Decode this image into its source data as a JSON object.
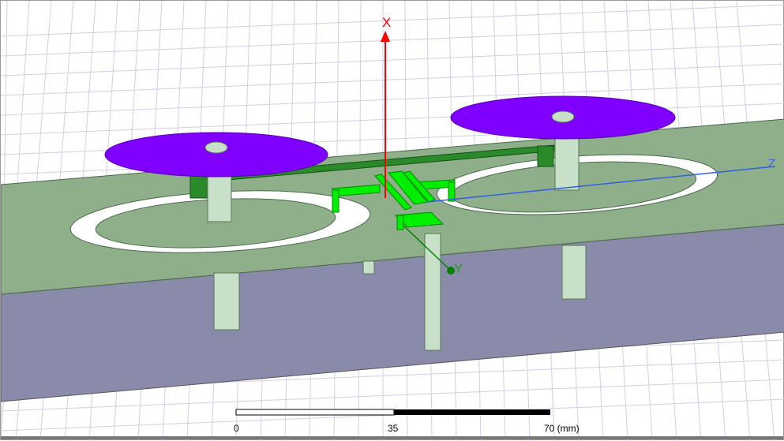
{
  "viewport": {
    "title": "3D Modeler View"
  },
  "axes": {
    "x_label": "X",
    "y_label": "Y",
    "z_label": "Z",
    "x_color": "#ff0000",
    "y_color": "#008000",
    "z_color": "#3060e0"
  },
  "scale_bar": {
    "ticks": [
      "0",
      "35",
      "70 (mm)"
    ],
    "units": "mm"
  },
  "colors": {
    "substrate_top": "#8fae8a",
    "substrate_side": "#8a8aaa",
    "disc": "#8000ff",
    "post": "#c8e0c8",
    "feed": "#00ee00",
    "grid": "#cdd0e6"
  }
}
